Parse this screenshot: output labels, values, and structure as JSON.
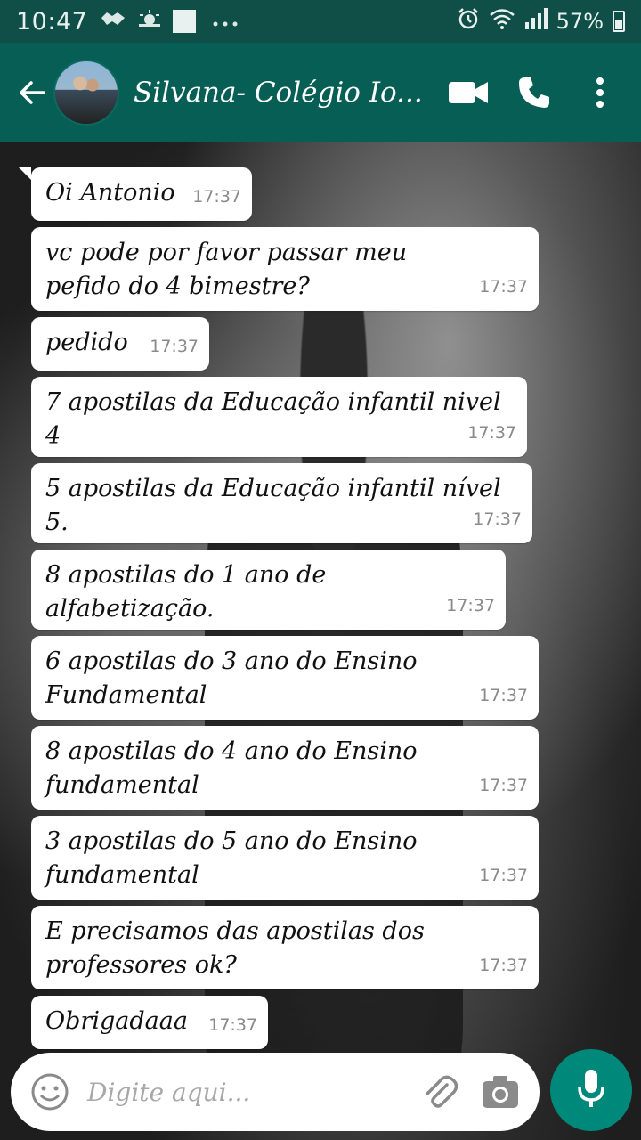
{
  "status_bar": {
    "time": "10:47",
    "battery_percent": "57%",
    "icons": [
      "handshake-icon",
      "weather-icon",
      "square-icon",
      "more-dots-icon",
      "alarm-icon",
      "wifi-icon",
      "signal-icon",
      "battery-icon"
    ]
  },
  "header": {
    "contact_name": "Silvana- Colégio Io...",
    "icons": [
      "back-arrow-icon",
      "avatar",
      "video-call-icon",
      "phone-icon",
      "more-vert-icon"
    ]
  },
  "messages": [
    {
      "text": "Oi Antonio",
      "time": "17:37"
    },
    {
      "text": "vc pode por favor passar meu pefido do 4 bimestre?",
      "time": "17:37"
    },
    {
      "text": "pedido",
      "time": "17:37"
    },
    {
      "text": "7 apostilas da Educação infantil nivel 4",
      "time": "17:37"
    },
    {
      "text": "5 apostilas da Educação infantil nível 5.",
      "time": "17:37"
    },
    {
      "text": "8 apostilas do 1 ano de alfabetização.",
      "time": "17:37"
    },
    {
      "text": "6 apostilas do 3 ano do Ensino Fundamental",
      "time": "17:37"
    },
    {
      "text": "8 apostilas do 4 ano do Ensino fundamental",
      "time": "17:37"
    },
    {
      "text": "3 apostilas do 5 ano do Ensino fundamental",
      "time": "17:37"
    },
    {
      "text": "E precisamos das apostilas dos professores ok?",
      "time": "17:37"
    },
    {
      "text": "Obrigadaaa",
      "time": "17:37"
    }
  ],
  "composer": {
    "placeholder": "Digite aqui...",
    "icons": [
      "emoji-icon",
      "attach-icon",
      "camera-icon",
      "mic-icon"
    ]
  },
  "colors": {
    "status_bar": "#0f4f47",
    "app_bar": "#075e54",
    "mic_button": "#00897b",
    "bubble": "#ffffff"
  }
}
